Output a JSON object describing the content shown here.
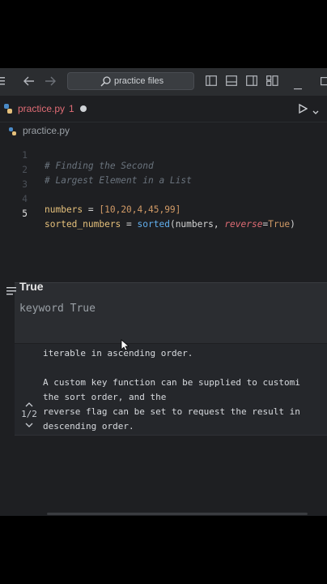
{
  "titlebar": {
    "search_label": "practice files",
    "icons": [
      "menu-icon",
      "back-arrow-icon",
      "forward-arrow-icon",
      "search-icon",
      "sidebar-left-icon",
      "panel-bottom-icon",
      "sidebar-right-icon",
      "layout-icon",
      "minimize-icon",
      "maximize-icon"
    ]
  },
  "tab": {
    "name": "practice.py",
    "problems": "1",
    "modified": true
  },
  "run": {
    "icon": "play-icon",
    "menu_icon": "chevron-down-icon"
  },
  "breadcrumb": {
    "file": "practice.py"
  },
  "code": {
    "line_numbers": [
      "1",
      "2",
      "3",
      "4",
      "5"
    ],
    "line1": "# Finding the Second",
    "line2": "# Largest Element in a List",
    "line4": {
      "var": "numbers",
      "op": " = ",
      "list": "[10,20,4,45,99]"
    },
    "line5": {
      "var": "sorted_numbers",
      "op": " = ",
      "fn": "sorted",
      "open": "(",
      "arg": "numbers, ",
      "kw": "reverse",
      "eq": "=",
      "val": "True",
      "close": ")"
    }
  },
  "hover": {
    "symbol": "True",
    "signature": "keyword True",
    "page": "1/2",
    "doc_lines": [
      "iterable in ascending order.",
      "",
      "A custom key function can be supplied to customi",
      "the sort order, and the",
      "reverse flag can be set to request the result in",
      "descending order."
    ]
  },
  "colors": {
    "accent_error": "#e06c75",
    "background": "#1e1f22"
  }
}
